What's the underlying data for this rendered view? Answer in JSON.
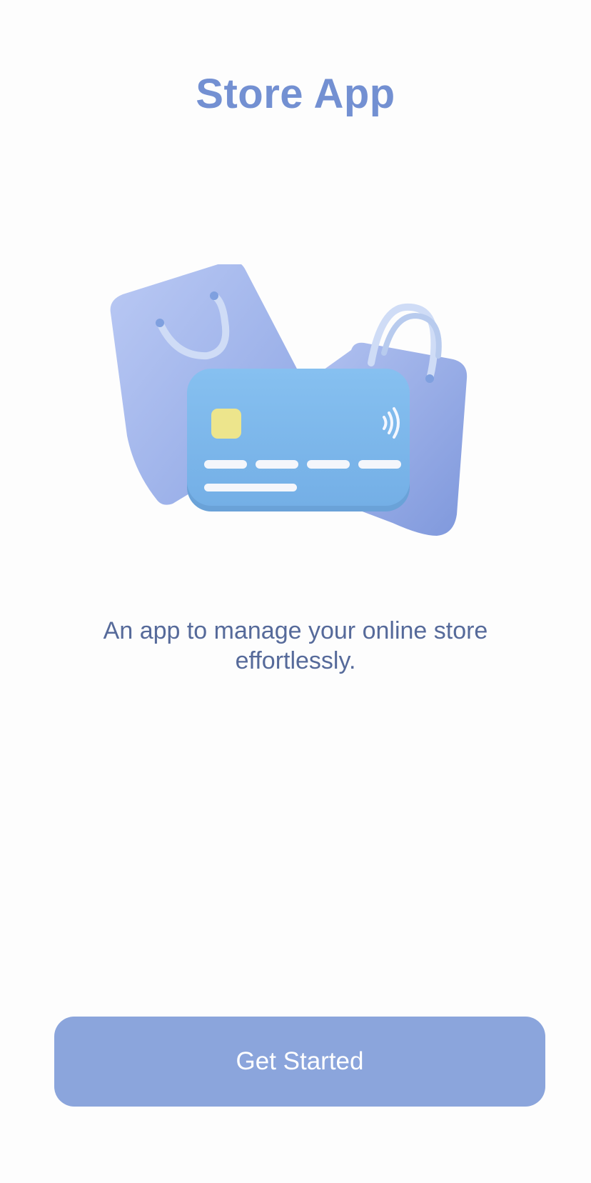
{
  "app": {
    "title": "Store App"
  },
  "hero": {
    "illustration": "shopping-bags-and-credit-card-illustration"
  },
  "intro": {
    "tagline": "An app to manage your online store effortlessly."
  },
  "actions": {
    "primary_label": "Get Started"
  },
  "colors": {
    "title": "#7390d2",
    "tagline": "#566a9a",
    "button": "#8ba5dc",
    "background": "#fdfdfd",
    "card": "#80bbee",
    "bag": "#a9bcef",
    "chip": "#ede58c"
  }
}
